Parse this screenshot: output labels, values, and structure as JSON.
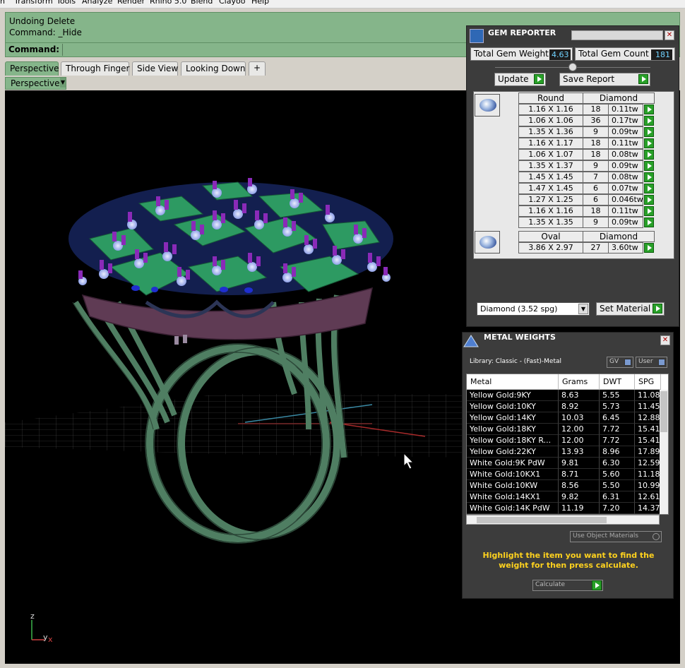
{
  "menu": [
    "n",
    "Transform",
    "Tools",
    "Analyze",
    "Render",
    "Rhino 5.0",
    "Blend",
    "Clayoo",
    "Help"
  ],
  "command": {
    "history": [
      "Undoing Delete",
      "Command: _Hide"
    ],
    "prompt_label": "Command:"
  },
  "viewport_tabs": [
    "Perspective",
    "Through Finger",
    "Side View",
    "Looking Down",
    "+"
  ],
  "viewport_label": "Perspective",
  "axis": {
    "z": "z",
    "x": "x",
    "y": "y"
  },
  "gem_reporter": {
    "title": "GEM REPORTER",
    "total_weight_label": "Total Gem Weight",
    "total_weight": "4.63",
    "total_count_label": "Total Gem Count",
    "total_count": "181",
    "update_label": "Update",
    "save_label": "Save Report",
    "round_group": {
      "header": [
        "Round",
        "Diamond"
      ],
      "rows": [
        [
          "1.16 X 1.16",
          "18",
          "0.11tw"
        ],
        [
          "1.06 X 1.06",
          "36",
          "0.17tw"
        ],
        [
          "1.35 X 1.36",
          "9",
          "0.09tw"
        ],
        [
          "1.16 X 1.17",
          "18",
          "0.11tw"
        ],
        [
          "1.06 X 1.07",
          "18",
          "0.08tw"
        ],
        [
          "1.35 X 1.37",
          "9",
          "0.09tw"
        ],
        [
          "1.45 X 1.45",
          "7",
          "0.08tw"
        ],
        [
          "1.47 X 1.45",
          "6",
          "0.07tw"
        ],
        [
          "1.27 X 1.25",
          "6",
          "0.046tw"
        ],
        [
          "1.16 X 1.16",
          "18",
          "0.11tw"
        ],
        [
          "1.35 X 1.35",
          "9",
          "0.09tw"
        ]
      ]
    },
    "oval_group": {
      "header": [
        "Oval",
        "Diamond"
      ],
      "rows": [
        [
          "3.86 X 2.97",
          "27",
          "3.60tw"
        ]
      ]
    },
    "material_value": "Diamond    (3.52 spg)",
    "set_material_label": "Set Material"
  },
  "metal_weights": {
    "title": "METAL WEIGHTS",
    "library": "Library: Classic - (Fast)-Metal",
    "gv_label": "GV",
    "user_label": "User",
    "columns": [
      "Metal",
      "Grams",
      "DWT",
      "SPG"
    ],
    "rows": [
      [
        "Yellow Gold:9KY",
        "8.63",
        "5.55",
        "11.08"
      ],
      [
        "Yellow Gold:10KY",
        "8.92",
        "5.73",
        "11.45"
      ],
      [
        "Yellow Gold:14KY",
        "10.03",
        "6.45",
        "12.88"
      ],
      [
        "Yellow Gold:18KY",
        "12.00",
        "7.72",
        "15.41"
      ],
      [
        "Yellow Gold:18KY R...",
        "12.00",
        "7.72",
        "15.41"
      ],
      [
        "Yellow Gold:22KY",
        "13.93",
        "8.96",
        "17.89"
      ],
      [
        "White Gold:9K PdW",
        "9.81",
        "6.30",
        "12.59"
      ],
      [
        "White Gold:10KX1",
        "8.71",
        "5.60",
        "11.18"
      ],
      [
        "White Gold:10KW",
        "8.56",
        "5.50",
        "10.99"
      ],
      [
        "White Gold:14KX1",
        "9.82",
        "6.31",
        "12.61"
      ],
      [
        "White Gold:14K PdW",
        "11.19",
        "7.20",
        "14.37"
      ]
    ],
    "use_object_label": "Use Object Materials",
    "hint": "Highlight the item you want to find the weight for then press calculate.",
    "calculate_label": "Calculate"
  }
}
